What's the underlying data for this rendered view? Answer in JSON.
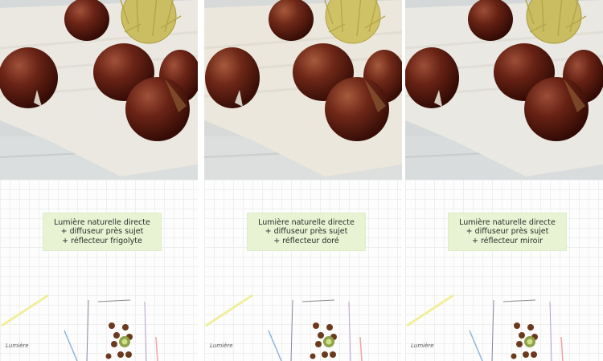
{
  "panels": [
    {
      "note_lines": [
        "Lumière naturelle directe",
        "+ diffuseur près sujet",
        "+ réflecteur frigolyte"
      ],
      "light_label": "Lumière"
    },
    {
      "note_lines": [
        "Lumière naturelle directe",
        "+ diffuseur près sujet",
        "+ réflecteur doré"
      ],
      "light_label": "Lumière"
    },
    {
      "note_lines": [
        "Lumière naturelle directe",
        "+ diffuseur près sujet",
        "+ réflecteur miroir"
      ],
      "light_label": "Lumière"
    }
  ],
  "colors": {
    "chestnut": "#5a1e12",
    "burlap": "#e9e6df",
    "wood": "#d9dcdc",
    "note": "#e8f3d3",
    "burr": "#b9ae55"
  }
}
